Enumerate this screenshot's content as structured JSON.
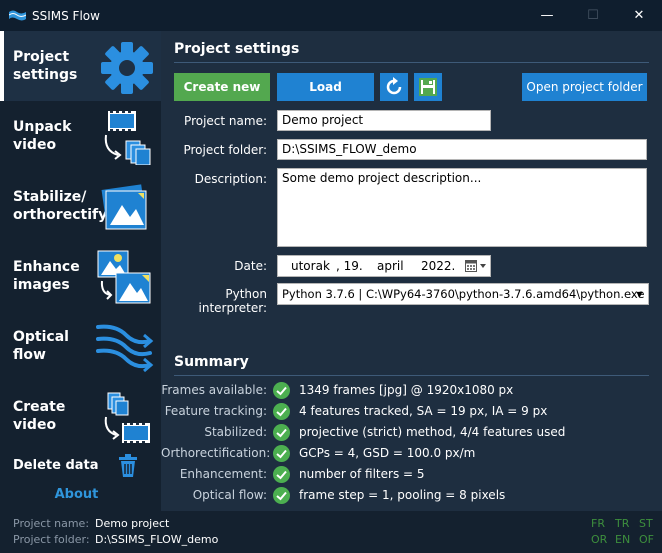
{
  "app": {
    "title": "SSIMS Flow"
  },
  "window": {
    "minimize": "—",
    "maximize": "☐",
    "close": "✕"
  },
  "sidebar": {
    "items": [
      {
        "label": "Project\nsettings"
      },
      {
        "label": "Unpack\nvideo"
      },
      {
        "label": "Stabilize/\northorectify"
      },
      {
        "label": "Enhance\nimages"
      },
      {
        "label": "Optical\nflow"
      },
      {
        "label": "Create\nvideo"
      }
    ],
    "delete_label": "Delete data",
    "about_label": "About"
  },
  "settings": {
    "title": "Project settings",
    "create_new": "Create new",
    "load": "Load",
    "open_folder": "Open project folder",
    "project_name_label": "Project name:",
    "project_name": "Demo project",
    "project_folder_label": "Project folder:",
    "project_folder": "D:\\SSIMS_FLOW_demo",
    "description_label": "Description:",
    "description": "Some demo project description...",
    "date_label": "Date:",
    "date": {
      "weekday": "utorak",
      "day": ", 19.",
      "month": "april",
      "year": "2022."
    },
    "python_label": "Python interpreter:",
    "python_value": "Python 3.7.6 | C:\\WPy64-3760\\python-3.7.6.amd64\\python.exe"
  },
  "summary": {
    "title": "Summary",
    "rows": [
      {
        "label": "Frames available:",
        "value": "1349 frames [jpg] @ 1920x1080 px"
      },
      {
        "label": "Feature tracking:",
        "value": "4 features tracked, SA = 19 px, IA = 9 px"
      },
      {
        "label": "Stabilized:",
        "value": "projective (strict) method, 4/4 features used"
      },
      {
        "label": "Orthorectification:",
        "value": "GCPs = 4, GSD = 100.0 px/m"
      },
      {
        "label": "Enhancement:",
        "value": "number of filters = 5"
      },
      {
        "label": "Optical flow:",
        "value": "frame step = 1, pooling = 8 pixels"
      }
    ]
  },
  "status": {
    "name_label": "Project name:",
    "name_value": "Demo project",
    "folder_label": "Project folder:",
    "folder_value": "D:\\SSIMS_FLOW_demo",
    "languages": [
      "FR",
      "TR",
      "ST",
      "OR",
      "EN",
      "OF"
    ]
  },
  "colors": {
    "accent_blue": "#1f82d2",
    "create_green": "#53a84f",
    "check_green": "#4caf50",
    "about_blue": "#2f95db"
  }
}
